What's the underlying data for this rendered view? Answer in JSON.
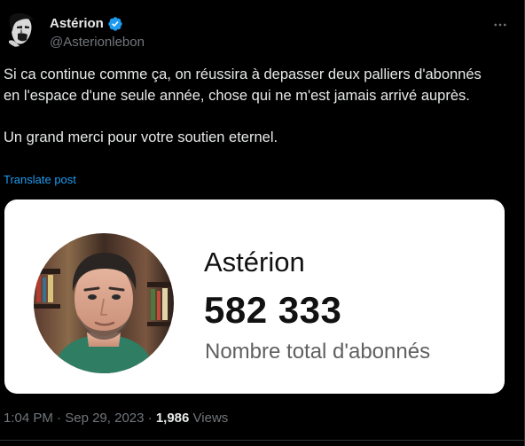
{
  "colors": {
    "background": "#000000",
    "text_primary": "#e7e9ea",
    "text_secondary": "#71767b",
    "link_blue": "#1d9bf0",
    "verified_badge": "#1d9bf0",
    "card_background": "#ffffff"
  },
  "author": {
    "display_name": "Astérion",
    "handle": "@Asterionlebon",
    "verified": true,
    "avatar_icon": "avatar-face-icon"
  },
  "header": {
    "more_icon": "more-horizontal-icon"
  },
  "tweet": {
    "paragraphs": [
      "Si ca continue comme ça,  on réussira à depasser deux palliers d'abonnés en l'espace d'une seule année,  chose qui ne m'est jamais arrivé auprès.",
      "Un grand merci pour votre soutien eternel."
    ],
    "translate_label": "Translate post"
  },
  "media": {
    "channel_name": "Astérion",
    "subscriber_count": "582 333",
    "subscriber_label": "Nombre total d'abonnés"
  },
  "meta": {
    "time": "1:04 PM",
    "separator": "·",
    "date": "Sep 29, 2023",
    "views_count": "1,986",
    "views_label": "Views"
  }
}
